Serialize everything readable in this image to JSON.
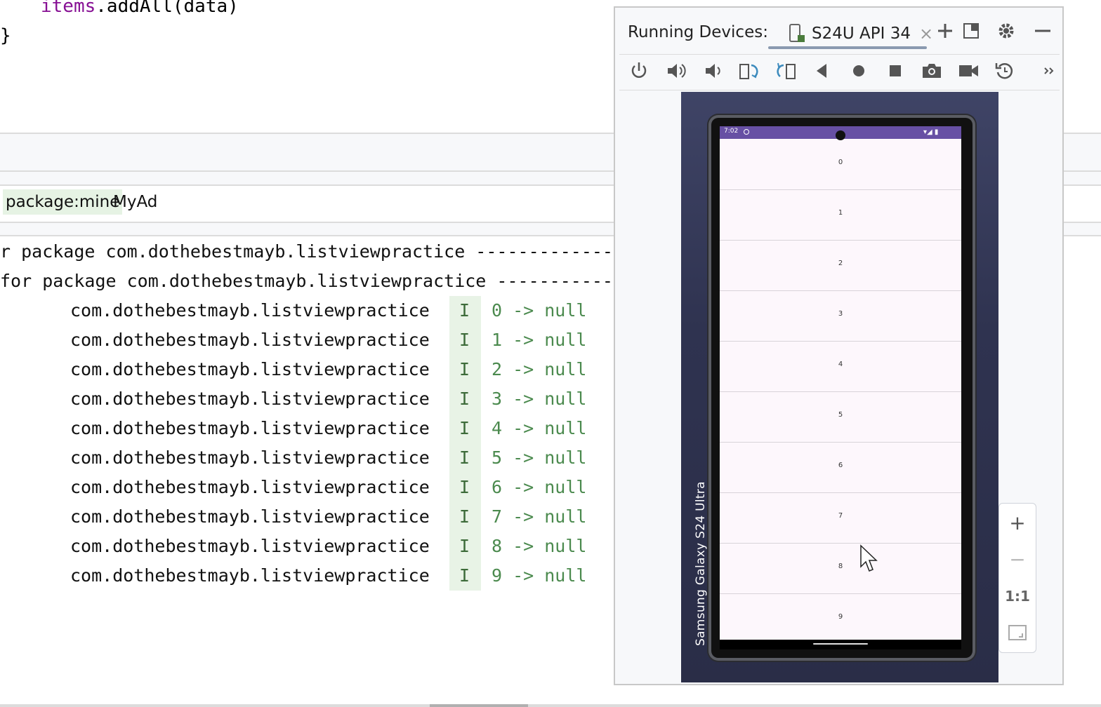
{
  "editor": {
    "line1": {
      "var": "items",
      "rest": ".addAll(data)"
    },
    "line2": "}"
  },
  "logcat": {
    "filter_chip": "package:mine",
    "filter_rest": "MyAd",
    "header_lines": [
      "r package com.dothebestmayb.listviewpractice -------------",
      "for package com.dothebestmayb.listviewpractice -----------"
    ],
    "entries": [
      {
        "tag": "com.dothebestmayb.listviewpractice",
        "level": "I",
        "msg": "0 -> null"
      },
      {
        "tag": "com.dothebestmayb.listviewpractice",
        "level": "I",
        "msg": "1 -> null"
      },
      {
        "tag": "com.dothebestmayb.listviewpractice",
        "level": "I",
        "msg": "2 -> null"
      },
      {
        "tag": "com.dothebestmayb.listviewpractice",
        "level": "I",
        "msg": "3 -> null"
      },
      {
        "tag": "com.dothebestmayb.listviewpractice",
        "level": "I",
        "msg": "4 -> null"
      },
      {
        "tag": "com.dothebestmayb.listviewpractice",
        "level": "I",
        "msg": "5 -> null"
      },
      {
        "tag": "com.dothebestmayb.listviewpractice",
        "level": "I",
        "msg": "6 -> null"
      },
      {
        "tag": "com.dothebestmayb.listviewpractice",
        "level": "I",
        "msg": "7 -> null"
      },
      {
        "tag": "com.dothebestmayb.listviewpractice",
        "level": "I",
        "msg": "8 -> null"
      },
      {
        "tag": "com.dothebestmayb.listviewpractice",
        "level": "I",
        "msg": "9 -> null"
      }
    ]
  },
  "running_devices": {
    "title": "Running Devices:",
    "tab_label": "S24U API 34",
    "tab_close": "×",
    "header_icons": [
      "plus-icon",
      "layout-icon",
      "gear-icon",
      "minimize-icon"
    ],
    "toolbar_icons": [
      "power-icon",
      "volume-up-icon",
      "volume-down-icon",
      "rotate-left-icon",
      "rotate-right-icon",
      "back-icon",
      "home-icon",
      "overview-icon",
      "screenshot-icon",
      "screen-record-icon",
      "reset-icon",
      "more-icon"
    ],
    "device_label": "Samsung Galaxy  S24 Ultra",
    "status_time": "7:02",
    "list_items": [
      "0",
      "1",
      "2",
      "3",
      "4",
      "5",
      "6",
      "7",
      "8",
      "9"
    ],
    "zoom": {
      "plus": "+",
      "minus": "−",
      "actual": "1:1"
    }
  },
  "colors": {
    "status_bar": "#6750a4",
    "log_msg": "#4b8a4e",
    "code_var": "#871094"
  }
}
